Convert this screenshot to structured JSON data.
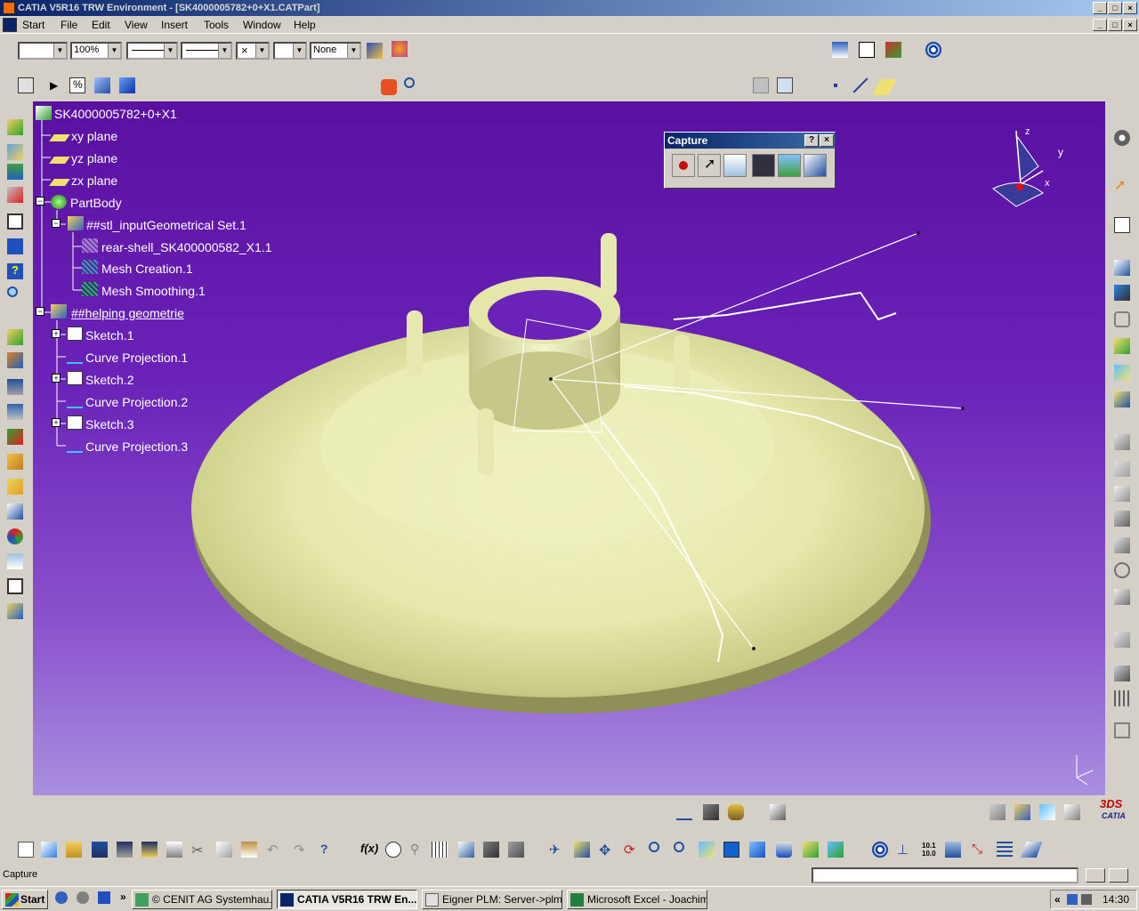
{
  "window": {
    "title": "CATIA V5R16 TRW Environment - [SK4000005782+0+X1.CATPart]"
  },
  "menu": {
    "items": [
      "Start",
      "File",
      "Edit",
      "View",
      "Insert",
      "Tools",
      "Window",
      "Help"
    ]
  },
  "toolbar": {
    "zoom": "100%",
    "layer": "None"
  },
  "tree": {
    "root": "SK4000005782+0+X1",
    "nodes": [
      "xy plane",
      "yz plane",
      "zx plane",
      "PartBody",
      "##stl_inputGeometrical Set.1",
      "rear-shell_SK400000582_X1.1",
      "Mesh Creation.1",
      "Mesh Smoothing.1",
      "##helping geometrie",
      "Sketch.1",
      "Curve Projection.1",
      "Sketch.2",
      "Curve Projection.2",
      "Sketch.3",
      "Curve Projection.3"
    ]
  },
  "capture_toolbar": {
    "title": "Capture",
    "help": "?",
    "close": "×"
  },
  "compass": {
    "z": "z",
    "y": "y",
    "x": "x"
  },
  "status": {
    "text": "Capture"
  },
  "taskbar": {
    "start": "Start",
    "chevron": "»",
    "tasks": [
      "© CENIT AG Systemhau...",
      "CATIA V5R16 TRW En...",
      "Eigner PLM: Server->plm...",
      "Microsoft Excel - Joachim..."
    ],
    "clock": "14:30"
  },
  "brand": {
    "logo": "CATIA"
  },
  "colors": {
    "viewport_top": "#5a10a0",
    "viewport_bottom": "#a98fe0",
    "part": "#e8eab0",
    "titlebar": "#0a246a"
  }
}
